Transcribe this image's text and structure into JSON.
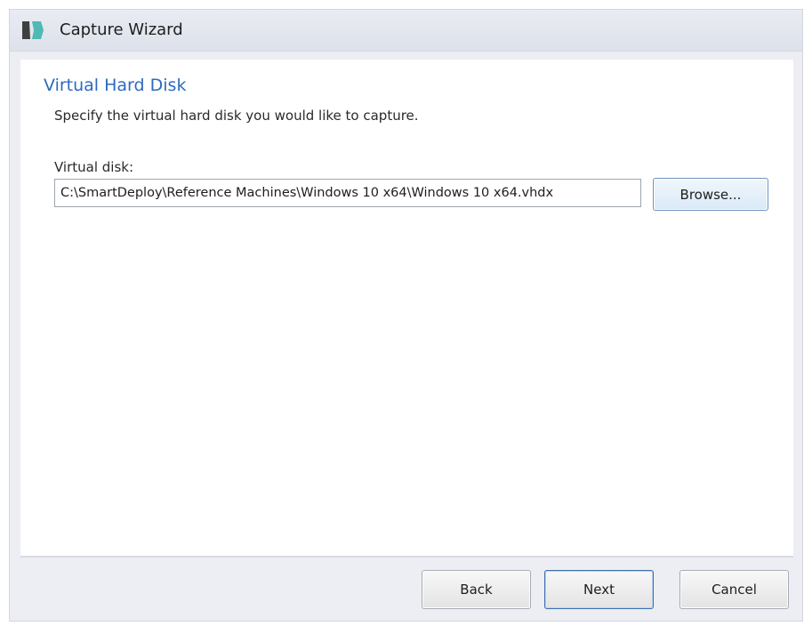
{
  "window": {
    "title": "Capture Wizard",
    "logo_icon": "smartdeploy-logo-icon"
  },
  "page": {
    "title": "Virtual Hard Disk",
    "subtitle": "Specify the virtual hard disk you would like to capture."
  },
  "form": {
    "virtual_disk_label": "Virtual disk:",
    "virtual_disk_value": "C:\\SmartDeploy\\Reference Machines\\Windows 10 x64\\Windows 10 x64.vhdx",
    "browse_label": "Browse..."
  },
  "footer": {
    "back_label": "Back",
    "next_label": "Next",
    "cancel_label": "Cancel"
  },
  "colors": {
    "accent": "#2d6abf",
    "titlebar": "#e3e6ed",
    "window_frame": "#eceef3",
    "logo_dark": "#3f3f3f",
    "logo_teal": "#4fb9b3"
  }
}
